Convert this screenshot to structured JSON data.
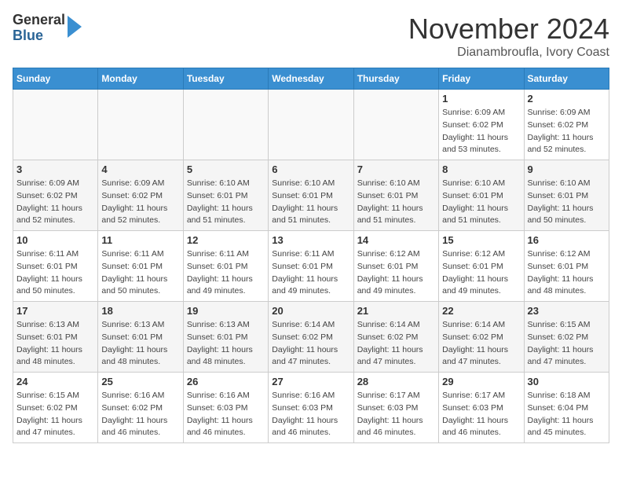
{
  "header": {
    "logo_line1": "General",
    "logo_line2": "Blue",
    "month": "November 2024",
    "location": "Dianambroufla, Ivory Coast"
  },
  "weekdays": [
    "Sunday",
    "Monday",
    "Tuesday",
    "Wednesday",
    "Thursday",
    "Friday",
    "Saturday"
  ],
  "weeks": [
    [
      {
        "day": "",
        "sunrise": "",
        "sunset": "",
        "daylight": ""
      },
      {
        "day": "",
        "sunrise": "",
        "sunset": "",
        "daylight": ""
      },
      {
        "day": "",
        "sunrise": "",
        "sunset": "",
        "daylight": ""
      },
      {
        "day": "",
        "sunrise": "",
        "sunset": "",
        "daylight": ""
      },
      {
        "day": "",
        "sunrise": "",
        "sunset": "",
        "daylight": ""
      },
      {
        "day": "1",
        "sunrise": "Sunrise: 6:09 AM",
        "sunset": "Sunset: 6:02 PM",
        "daylight": "Daylight: 11 hours and 53 minutes."
      },
      {
        "day": "2",
        "sunrise": "Sunrise: 6:09 AM",
        "sunset": "Sunset: 6:02 PM",
        "daylight": "Daylight: 11 hours and 52 minutes."
      }
    ],
    [
      {
        "day": "3",
        "sunrise": "Sunrise: 6:09 AM",
        "sunset": "Sunset: 6:02 PM",
        "daylight": "Daylight: 11 hours and 52 minutes."
      },
      {
        "day": "4",
        "sunrise": "Sunrise: 6:09 AM",
        "sunset": "Sunset: 6:02 PM",
        "daylight": "Daylight: 11 hours and 52 minutes."
      },
      {
        "day": "5",
        "sunrise": "Sunrise: 6:10 AM",
        "sunset": "Sunset: 6:01 PM",
        "daylight": "Daylight: 11 hours and 51 minutes."
      },
      {
        "day": "6",
        "sunrise": "Sunrise: 6:10 AM",
        "sunset": "Sunset: 6:01 PM",
        "daylight": "Daylight: 11 hours and 51 minutes."
      },
      {
        "day": "7",
        "sunrise": "Sunrise: 6:10 AM",
        "sunset": "Sunset: 6:01 PM",
        "daylight": "Daylight: 11 hours and 51 minutes."
      },
      {
        "day": "8",
        "sunrise": "Sunrise: 6:10 AM",
        "sunset": "Sunset: 6:01 PM",
        "daylight": "Daylight: 11 hours and 51 minutes."
      },
      {
        "day": "9",
        "sunrise": "Sunrise: 6:10 AM",
        "sunset": "Sunset: 6:01 PM",
        "daylight": "Daylight: 11 hours and 50 minutes."
      }
    ],
    [
      {
        "day": "10",
        "sunrise": "Sunrise: 6:11 AM",
        "sunset": "Sunset: 6:01 PM",
        "daylight": "Daylight: 11 hours and 50 minutes."
      },
      {
        "day": "11",
        "sunrise": "Sunrise: 6:11 AM",
        "sunset": "Sunset: 6:01 PM",
        "daylight": "Daylight: 11 hours and 50 minutes."
      },
      {
        "day": "12",
        "sunrise": "Sunrise: 6:11 AM",
        "sunset": "Sunset: 6:01 PM",
        "daylight": "Daylight: 11 hours and 49 minutes."
      },
      {
        "day": "13",
        "sunrise": "Sunrise: 6:11 AM",
        "sunset": "Sunset: 6:01 PM",
        "daylight": "Daylight: 11 hours and 49 minutes."
      },
      {
        "day": "14",
        "sunrise": "Sunrise: 6:12 AM",
        "sunset": "Sunset: 6:01 PM",
        "daylight": "Daylight: 11 hours and 49 minutes."
      },
      {
        "day": "15",
        "sunrise": "Sunrise: 6:12 AM",
        "sunset": "Sunset: 6:01 PM",
        "daylight": "Daylight: 11 hours and 49 minutes."
      },
      {
        "day": "16",
        "sunrise": "Sunrise: 6:12 AM",
        "sunset": "Sunset: 6:01 PM",
        "daylight": "Daylight: 11 hours and 48 minutes."
      }
    ],
    [
      {
        "day": "17",
        "sunrise": "Sunrise: 6:13 AM",
        "sunset": "Sunset: 6:01 PM",
        "daylight": "Daylight: 11 hours and 48 minutes."
      },
      {
        "day": "18",
        "sunrise": "Sunrise: 6:13 AM",
        "sunset": "Sunset: 6:01 PM",
        "daylight": "Daylight: 11 hours and 48 minutes."
      },
      {
        "day": "19",
        "sunrise": "Sunrise: 6:13 AM",
        "sunset": "Sunset: 6:01 PM",
        "daylight": "Daylight: 11 hours and 48 minutes."
      },
      {
        "day": "20",
        "sunrise": "Sunrise: 6:14 AM",
        "sunset": "Sunset: 6:02 PM",
        "daylight": "Daylight: 11 hours and 47 minutes."
      },
      {
        "day": "21",
        "sunrise": "Sunrise: 6:14 AM",
        "sunset": "Sunset: 6:02 PM",
        "daylight": "Daylight: 11 hours and 47 minutes."
      },
      {
        "day": "22",
        "sunrise": "Sunrise: 6:14 AM",
        "sunset": "Sunset: 6:02 PM",
        "daylight": "Daylight: 11 hours and 47 minutes."
      },
      {
        "day": "23",
        "sunrise": "Sunrise: 6:15 AM",
        "sunset": "Sunset: 6:02 PM",
        "daylight": "Daylight: 11 hours and 47 minutes."
      }
    ],
    [
      {
        "day": "24",
        "sunrise": "Sunrise: 6:15 AM",
        "sunset": "Sunset: 6:02 PM",
        "daylight": "Daylight: 11 hours and 47 minutes."
      },
      {
        "day": "25",
        "sunrise": "Sunrise: 6:16 AM",
        "sunset": "Sunset: 6:02 PM",
        "daylight": "Daylight: 11 hours and 46 minutes."
      },
      {
        "day": "26",
        "sunrise": "Sunrise: 6:16 AM",
        "sunset": "Sunset: 6:03 PM",
        "daylight": "Daylight: 11 hours and 46 minutes."
      },
      {
        "day": "27",
        "sunrise": "Sunrise: 6:16 AM",
        "sunset": "Sunset: 6:03 PM",
        "daylight": "Daylight: 11 hours and 46 minutes."
      },
      {
        "day": "28",
        "sunrise": "Sunrise: 6:17 AM",
        "sunset": "Sunset: 6:03 PM",
        "daylight": "Daylight: 11 hours and 46 minutes."
      },
      {
        "day": "29",
        "sunrise": "Sunrise: 6:17 AM",
        "sunset": "Sunset: 6:03 PM",
        "daylight": "Daylight: 11 hours and 46 minutes."
      },
      {
        "day": "30",
        "sunrise": "Sunrise: 6:18 AM",
        "sunset": "Sunset: 6:04 PM",
        "daylight": "Daylight: 11 hours and 45 minutes."
      }
    ]
  ]
}
